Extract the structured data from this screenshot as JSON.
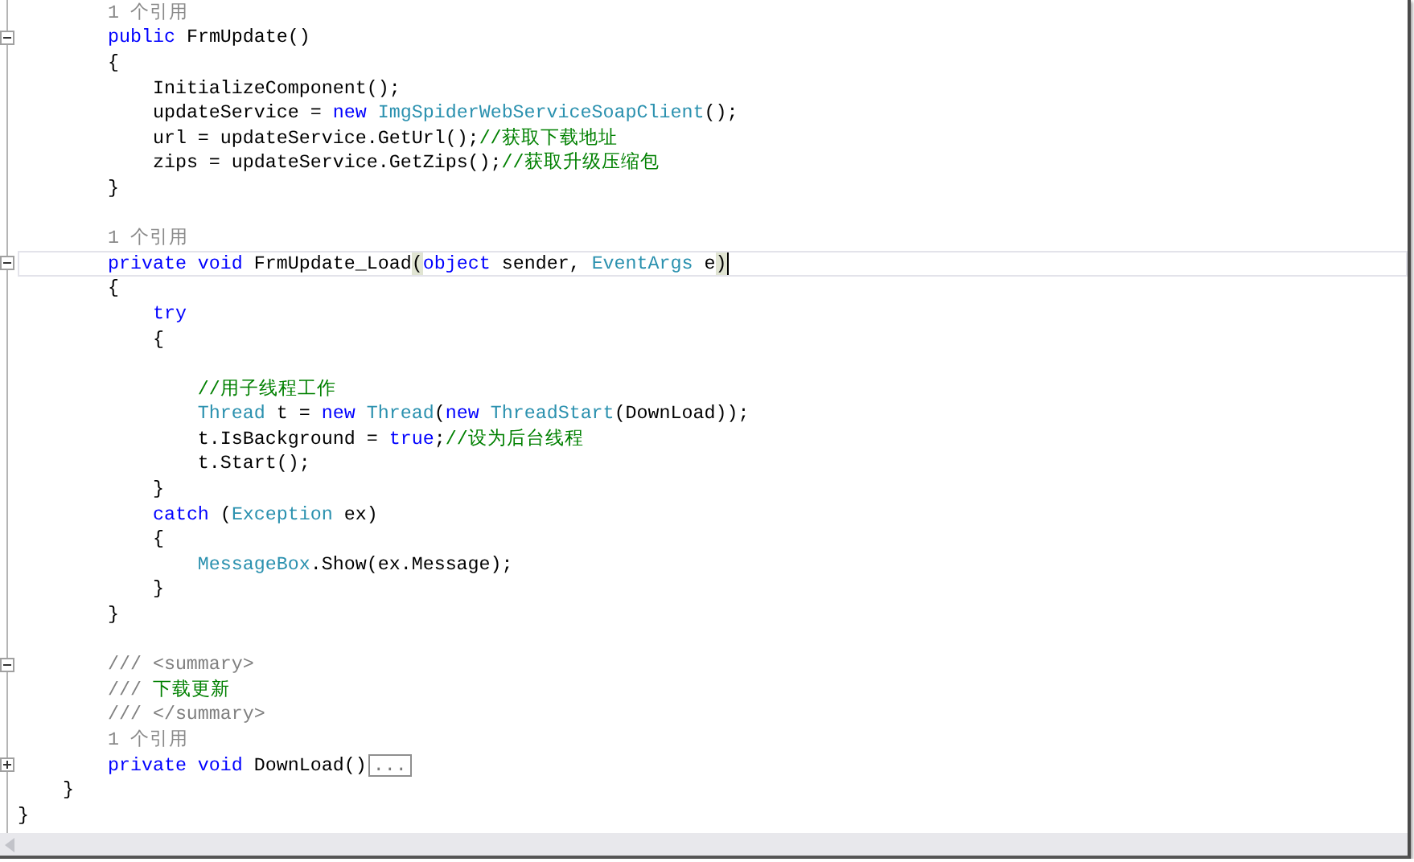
{
  "lines": [
    {
      "current": false,
      "tokens": [
        {
          "kind": "lens",
          "text": "        1 个引用"
        }
      ]
    },
    {
      "current": false,
      "fold": {
        "expanded": true
      },
      "tokens": [
        {
          "kind": "keyword",
          "text": "        public"
        },
        {
          "kind": "plain",
          "text": " FrmUpdate()"
        }
      ]
    },
    {
      "current": false,
      "tokens": [
        {
          "kind": "plain",
          "text": "        {"
        }
      ]
    },
    {
      "current": false,
      "tokens": [
        {
          "kind": "plain",
          "text": "            InitializeComponent();"
        }
      ]
    },
    {
      "current": false,
      "tokens": [
        {
          "kind": "plain",
          "text": "            updateService = "
        },
        {
          "kind": "keyword",
          "text": "new"
        },
        {
          "kind": "type",
          "text": " ImgSpiderWebServiceSoapClient"
        },
        {
          "kind": "plain",
          "text": "();"
        }
      ]
    },
    {
      "current": false,
      "tokens": [
        {
          "kind": "plain",
          "text": "            url = updateService.GetUrl();"
        },
        {
          "kind": "comment",
          "text": "//获取下载地址"
        }
      ]
    },
    {
      "current": false,
      "tokens": [
        {
          "kind": "plain",
          "text": "            zips = updateService.GetZips();"
        },
        {
          "kind": "comment",
          "text": "//获取升级压缩包"
        }
      ]
    },
    {
      "current": false,
      "tokens": [
        {
          "kind": "plain",
          "text": "        }"
        }
      ]
    },
    {
      "current": false
    },
    {
      "current": false,
      "tokens": [
        {
          "kind": "lens",
          "text": "        1 个引用"
        }
      ]
    },
    {
      "current": true,
      "fold": {
        "expanded": true
      },
      "tokens": [
        {
          "kind": "keyword",
          "text": "        private void"
        },
        {
          "kind": "plain",
          "text": " FrmUpdate_Load"
        },
        {
          "kind": "brace-match",
          "text": "("
        },
        {
          "kind": "keyword",
          "text": "object"
        },
        {
          "kind": "plain",
          "text": " sender, "
        },
        {
          "kind": "type",
          "text": "EventArgs"
        },
        {
          "kind": "plain",
          "text": " e"
        },
        {
          "kind": "brace-match",
          "text": ")"
        }
      ]
    },
    {
      "current": false,
      "tokens": [
        {
          "kind": "plain",
          "text": "        {"
        }
      ]
    },
    {
      "current": false,
      "tokens": [
        {
          "kind": "keyword",
          "text": "            try"
        }
      ]
    },
    {
      "current": false,
      "tokens": [
        {
          "kind": "plain",
          "text": "            {"
        }
      ]
    },
    {
      "current": false
    },
    {
      "current": false,
      "tokens": [
        {
          "kind": "comment",
          "text": "                //用子线程工作"
        }
      ]
    },
    {
      "current": false,
      "tokens": [
        {
          "kind": "type",
          "text": "                Thread"
        },
        {
          "kind": "plain",
          "text": " t = "
        },
        {
          "kind": "keyword",
          "text": "new"
        },
        {
          "kind": "type",
          "text": " Thread"
        },
        {
          "kind": "plain",
          "text": "("
        },
        {
          "kind": "keyword",
          "text": "new"
        },
        {
          "kind": "type",
          "text": " ThreadStart"
        },
        {
          "kind": "plain",
          "text": "(DownLoad));"
        }
      ]
    },
    {
      "current": false,
      "tokens": [
        {
          "kind": "plain",
          "text": "                t.IsBackground = "
        },
        {
          "kind": "keyword",
          "text": "true"
        },
        {
          "kind": "plain",
          "text": ";"
        },
        {
          "kind": "comment",
          "text": "//设为后台线程"
        }
      ]
    },
    {
      "current": false,
      "tokens": [
        {
          "kind": "plain",
          "text": "                t.Start();"
        }
      ]
    },
    {
      "current": false,
      "tokens": [
        {
          "kind": "plain",
          "text": "            }"
        }
      ]
    },
    {
      "current": false,
      "tokens": [
        {
          "kind": "keyword",
          "text": "            catch"
        },
        {
          "kind": "plain",
          "text": " ("
        },
        {
          "kind": "type",
          "text": "Exception"
        },
        {
          "kind": "plain",
          "text": " ex)"
        }
      ]
    },
    {
      "current": false,
      "tokens": [
        {
          "kind": "plain",
          "text": "            {"
        }
      ]
    },
    {
      "current": false,
      "tokens": [
        {
          "kind": "type",
          "text": "                MessageBox"
        },
        {
          "kind": "plain",
          "text": ".Show(ex.Message);"
        }
      ]
    },
    {
      "current": false,
      "tokens": [
        {
          "kind": "plain",
          "text": "            }"
        }
      ]
    },
    {
      "current": false,
      "tokens": [
        {
          "kind": "plain",
          "text": "        }"
        }
      ]
    },
    {
      "current": false
    },
    {
      "current": false,
      "fold": {
        "expanded": true
      },
      "tokens": [
        {
          "kind": "doc",
          "text": "        /// <summary>"
        }
      ]
    },
    {
      "current": false,
      "tokens": [
        {
          "kind": "doc",
          "text": "        /// "
        },
        {
          "kind": "comment",
          "text": "下载更新"
        }
      ]
    },
    {
      "current": false,
      "tokens": [
        {
          "kind": "doc",
          "text": "        /// </summary>"
        }
      ]
    },
    {
      "current": false,
      "tokens": [
        {
          "kind": "lens",
          "text": "        1 个引用"
        }
      ]
    },
    {
      "current": false,
      "fold": {
        "expanded": false
      },
      "tokens": [
        {
          "kind": "keyword",
          "text": "        private void"
        },
        {
          "kind": "plain",
          "text": " DownLoad()"
        },
        {
          "kind": "collapsed",
          "text": "..."
        }
      ]
    },
    {
      "current": false,
      "tokens": [
        {
          "kind": "plain",
          "text": "    }"
        }
      ]
    },
    {
      "current": false,
      "tokens": [
        {
          "kind": "plain",
          "text": "}"
        }
      ]
    }
  ]
}
